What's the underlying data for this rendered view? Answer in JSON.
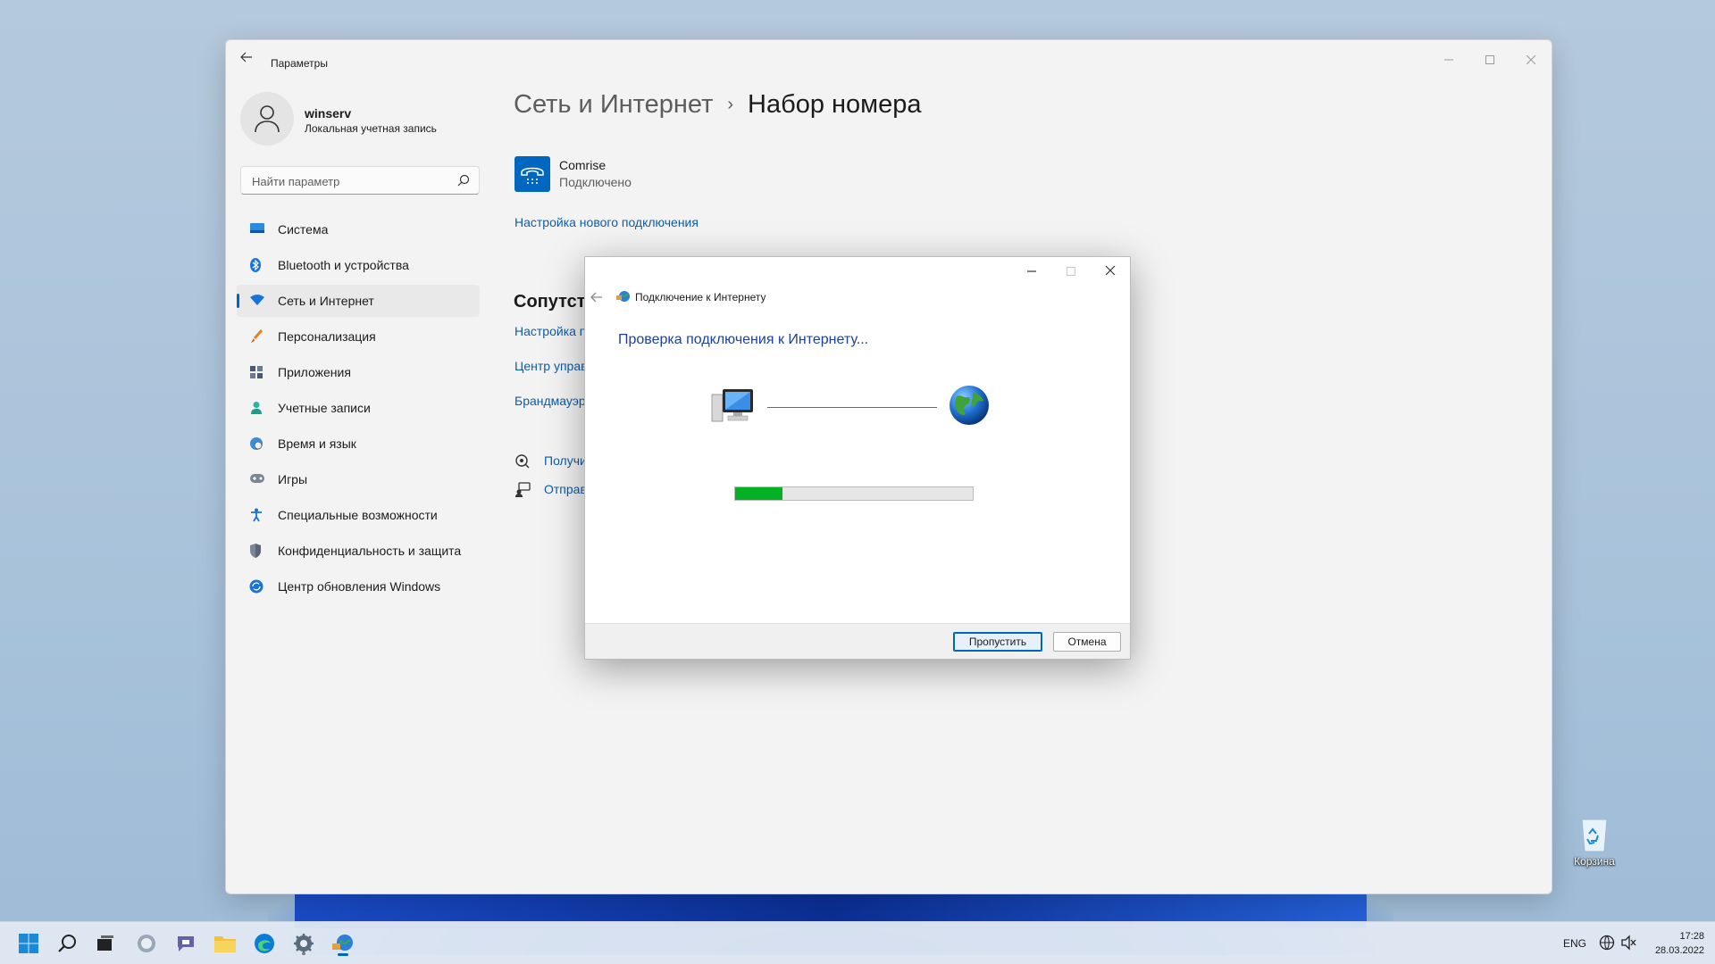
{
  "settings": {
    "app_title": "Параметры",
    "user": {
      "name": "winserv",
      "account_type": "Локальная учетная запись"
    },
    "search_placeholder": "Найти параметр",
    "nav": [
      {
        "label": "Система",
        "icon": "monitor-icon"
      },
      {
        "label": "Bluetooth и устройства",
        "icon": "bluetooth-icon"
      },
      {
        "label": "Сеть и Интернет",
        "icon": "wifi-icon",
        "active": true
      },
      {
        "label": "Персонализация",
        "icon": "brush-icon"
      },
      {
        "label": "Приложения",
        "icon": "apps-icon"
      },
      {
        "label": "Учетные записи",
        "icon": "person-icon"
      },
      {
        "label": "Время и язык",
        "icon": "globe-clock-icon"
      },
      {
        "label": "Игры",
        "icon": "gamepad-icon"
      },
      {
        "label": "Специальные возможности",
        "icon": "accessibility-icon"
      },
      {
        "label": "Конфиденциальность и защита",
        "icon": "shield-icon"
      },
      {
        "label": "Центр обновления Windows",
        "icon": "update-icon"
      }
    ],
    "breadcrumb": {
      "parent": "Сеть и Интернет",
      "separator": "›",
      "current": "Набор номера"
    },
    "connection": {
      "name": "Comrise",
      "status": "Подключено"
    },
    "new_connection_link": "Настройка нового подключения",
    "related": {
      "title": "Сопутств",
      "links": [
        "Настройка п",
        "Центр управ",
        "Брандмауэр"
      ]
    },
    "help": {
      "get_help": "Получи",
      "send_feedback": "Отправ"
    }
  },
  "dialog": {
    "title": "Подключение к Интернету",
    "heading": "Проверка подключения к Интернету...",
    "progress": 0.2,
    "skip_button": "Пропустить",
    "cancel_button": "Отмена"
  },
  "desktop": {
    "recycle_bin_label": "Корзина"
  },
  "taskbar": {
    "language": "ENG",
    "time": "17:28",
    "date": "28.03.2022"
  },
  "colors": {
    "accent": "#0067c0",
    "link": "#0f5ca8",
    "progress_fill": "#06b025",
    "dialog_heading": "#1c3fa4"
  }
}
